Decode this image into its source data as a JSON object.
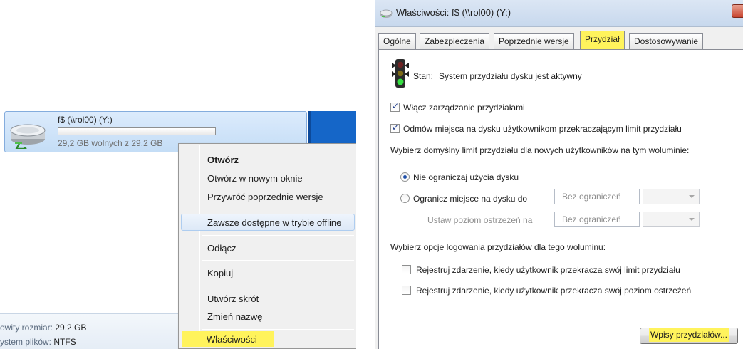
{
  "explorer": {
    "drive_name": "f$ (\\\\rol00) (Y:)",
    "drive_free": "29,2 GB wolnych z 29,2 GB",
    "drive_used_fraction": 0,
    "details": {
      "total_label": "owity rozmiar:",
      "total_value": "29,2 GB",
      "fs_label": "ystem plików:",
      "fs_value": "NTFS"
    }
  },
  "context_menu": {
    "items": [
      {
        "label": "Otwórz"
      },
      {
        "label": "Otwórz w nowym oknie"
      },
      {
        "label": "Przywróć poprzednie wersje"
      },
      {
        "label": "Zawsze dostępne w trybie offline"
      },
      {
        "label": "Odłącz"
      },
      {
        "label": "Kopiuj"
      },
      {
        "label": "Utwórz skrót"
      },
      {
        "label": "Zmień nazwę"
      },
      {
        "label": "Właściwości"
      }
    ]
  },
  "dialog": {
    "title": "Właściwości: f$ (\\\\rol00) (Y:)",
    "tabs": [
      {
        "label": "Ogólne"
      },
      {
        "label": "Zabezpieczenia"
      },
      {
        "label": "Poprzednie wersje"
      },
      {
        "label": "Przydział"
      },
      {
        "label": "Dostosowywanie"
      }
    ],
    "active_tab": "Przydział",
    "status_label": "Stan:",
    "status_text": "System przydziału dysku jest aktywny",
    "enable_quota": {
      "label": "Włącz zarządzanie przydziałami",
      "checked": true
    },
    "deny_space": {
      "label": "Odmów miejsca na dysku użytkownikom przekraczającym limit przydziału",
      "checked": true
    },
    "default_limit_heading": "Wybierz domyślny limit przydziału dla nowych użytkowników na tym woluminie:",
    "no_limit": {
      "label": "Nie ograniczaj użycia dysku",
      "selected": true
    },
    "limit_to": {
      "label": "Ogranicz miejsce na dysku do",
      "selected": false,
      "value": "Bez ograniczeń"
    },
    "warning_level": {
      "label": "Ustaw poziom ostrzeżeń na",
      "value": "Bez ograniczeń"
    },
    "logging_heading": "Wybierz opcje logowania przydziałów dla tego woluminu:",
    "log_limit": {
      "label": "Rejestruj zdarzenie, kiedy użytkownik przekracza swój limit przydziału",
      "checked": false
    },
    "log_warning": {
      "label": "Rejestruj zdarzenie, kiedy użytkownik przekracza swój poziom ostrzeżeń",
      "checked": false
    },
    "entries_button": "Wpisy przydziałów..."
  },
  "colors": {
    "highlight": "#fff35c",
    "selection_blue": "#c4ddf6",
    "desktop_blue": "#1566c8"
  },
  "icons": {
    "drive": "network-drive-icon",
    "status": "traffic-light-icon",
    "title": "drive-properties-icon",
    "close": "close-icon"
  }
}
